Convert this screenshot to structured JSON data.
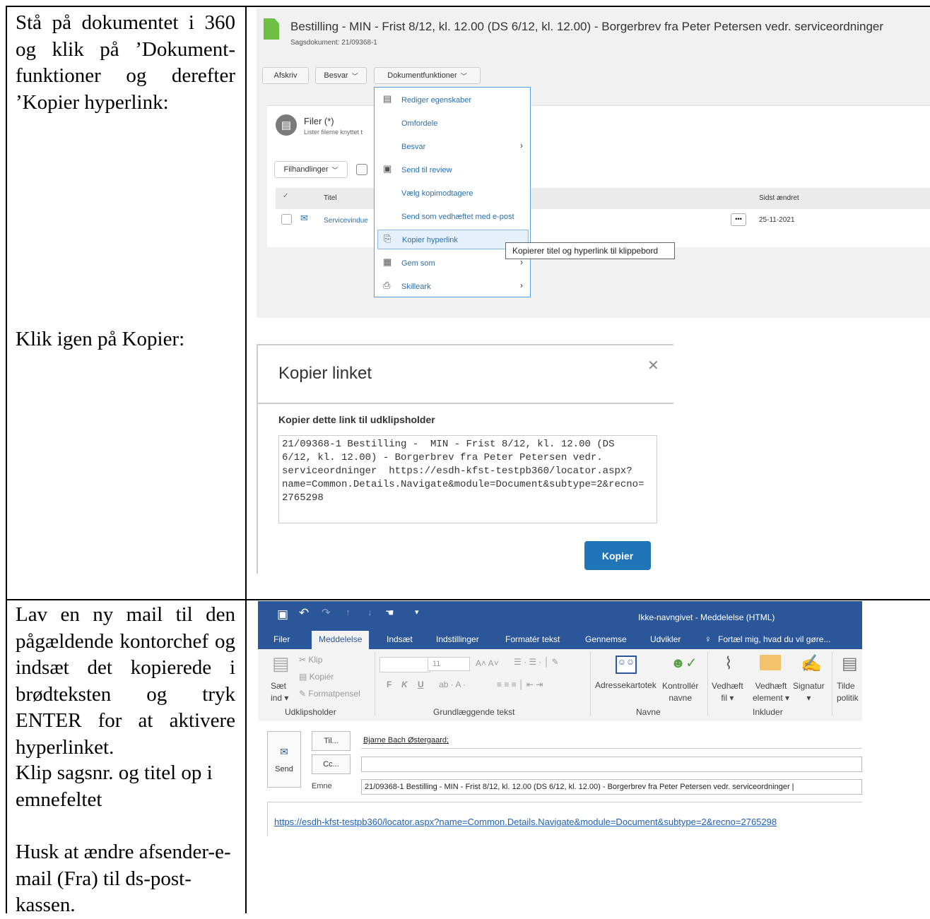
{
  "instructions": {
    "step1": "Stå på dokumentet i 360 og klik på ’Dokument-funktioner og derefter ’Kopier hyperlink:",
    "step2": "Klik igen på Kopier:",
    "step3a": "Lav en ny mail til den pågældende kontorchef og indsæt det kopierede i brødteksten og tryk ENTER for at aktivere hyperlinket.",
    "step3b": "Klip sagsnr. og titel op i emnefeltet",
    "step3c": "Husk at ændre afsender-e-mail (Fra) til ds-post-kassen."
  },
  "screenshot1": {
    "title": "Bestilling - MIN - Frist 8/12, kl. 12.00 (DS 6/12, kl. 12.00) - Borgerbrev fra Peter Petersen vedr. serviceordninger",
    "subtitle": "Sagsdokument: 21/09368-1",
    "buttons": {
      "afskriv": "Afskriv",
      "besvar": "Besvar",
      "dokfunk": "Dokumentfunktioner"
    },
    "files_title": "Filer (*)",
    "files_sub": "Lister filerne knyttet t",
    "filhandlinger": "Filhandlinger",
    "col_titel": "Titel",
    "col_sidst": "Sidst ændret",
    "row_title": "Servicevindue",
    "row_date": "25-11-2021",
    "menu": [
      {
        "label": "Rediger egenskaber",
        "icon": "edit-props-icon"
      },
      {
        "label": "Omfordele",
        "icon": ""
      },
      {
        "label": "Besvar",
        "icon": ""
      },
      {
        "label": "Send til review",
        "icon": "review-icon"
      },
      {
        "label": "Vælg kopimodtagere",
        "icon": ""
      },
      {
        "label": "Send som vedhæftet med e-post",
        "icon": ""
      },
      {
        "label": "Kopier hyperlink",
        "icon": "copy-link-icon"
      },
      {
        "label": "Gem som",
        "icon": "save-as-icon"
      },
      {
        "label": "Skilleark",
        "icon": "printer-icon"
      }
    ],
    "tooltip": "Kopierer titel og hyperlink til klippebord"
  },
  "screenshot2": {
    "title": "Kopier linket",
    "label": "Kopier dette link til udklipsholder",
    "text": "21/09368-1 Bestilling -  MIN - Frist 8/12, kl. 12.00 (DS\n6/12, kl. 12.00) - Borgerbrev fra Peter Petersen vedr.\nserviceordninger  https://esdh-kfst-testpb360/locator.aspx?\nname=Common.Details.Navigate&module=Document&subtype=2&recno=\n2765298",
    "button": "Kopier"
  },
  "screenshot3": {
    "window_title": "Ikke-navngivet - Meddelelse (HTML)",
    "tabs": [
      "Filer",
      "Meddelelse",
      "Indsæt",
      "Indstillinger",
      "Formatér tekst",
      "Gennemse",
      "Udvikler",
      "Fortæl mig, hvad du vil gøre..."
    ],
    "ribbon": {
      "klip": "Klip",
      "kopier": "Kopiér",
      "saet_ind_1": "Sæt",
      "saet_ind_2": "ind",
      "formatpensel": "Formatpensel",
      "fontsize": "11",
      "bold": "F",
      "italic": "K",
      "underline": "U",
      "adressekartotek": "Adressekartotek",
      "kontroller_1": "Kontrollér",
      "kontroller_2": "navne",
      "vedhaeft_fil_1": "Vedhæft",
      "vedhaeft_fil_2": "fil",
      "vedhaeft_el_1": "Vedhæft",
      "vedhaeft_el_2": "element",
      "signatur": "Signatur",
      "tilde_1": "Tilde",
      "tilde_2": "politik",
      "group_udklip": "Udklipsholder",
      "group_tekst": "Grundlæggende tekst",
      "group_navne": "Navne",
      "group_inkluder": "Inkluder"
    },
    "til_btn": "Til...",
    "cc_btn": "Cc...",
    "send_btn": "Send",
    "emne_label": "Emne",
    "til_value": "Bjarne Bach Østergaard;",
    "emne_value": "21/09368-1 Bestilling -  MIN - Frist 8/12, kl. 12.00 (DS 6/12, kl. 12.00) - Borgerbrev fra Peter Petersen vedr. serviceordninger",
    "body_link": "https://esdh-kfst-testpb360/locator.aspx?name=Common.Details.Navigate&module=Document&subtype=2&recno=2765298"
  }
}
